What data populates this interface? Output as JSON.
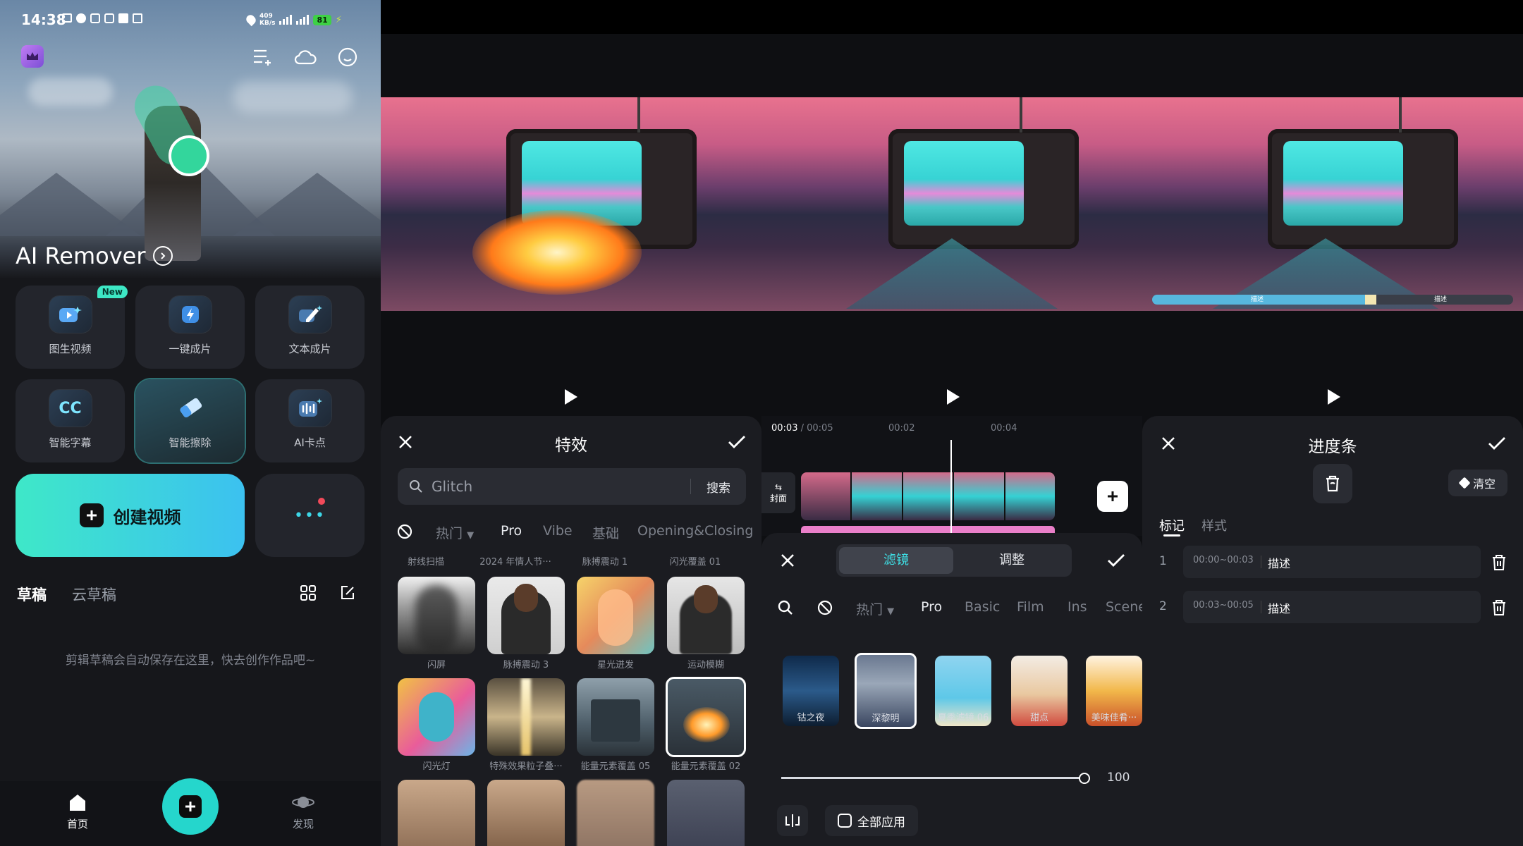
{
  "status_bar": {
    "time": "14:38",
    "net_speed": "409",
    "net_unit": "KB/s",
    "battery": "81"
  },
  "home": {
    "hero_title": "AI Remover",
    "tools": [
      {
        "label": "图生视频",
        "badge": "New"
      },
      {
        "label": "一键成片"
      },
      {
        "label": "文本成片"
      },
      {
        "label": "智能字幕",
        "icon_text": "CC"
      },
      {
        "label": "智能擦除"
      },
      {
        "label": "AI卡点"
      }
    ],
    "create_label": "创建视频",
    "more_label": "•••",
    "draft_tabs": [
      "草稿",
      "云草稿"
    ],
    "empty_text": "剪辑草稿会自动保存在这里，快去创作作品吧~",
    "nav": {
      "home": "首页",
      "discover": "发现"
    }
  },
  "effects": {
    "title": "特效",
    "search_placeholder": "Glitch",
    "search_button": "搜索",
    "tabs": [
      "热门",
      "Pro",
      "Vibe",
      "基础",
      "Opening&Closing"
    ],
    "active_tab": "Pro",
    "top_captions": [
      "射线扫描",
      "2024 年情人节···",
      "脉搏震动 1",
      "闪光覆盖 01"
    ],
    "items": [
      "闪屏",
      "脉搏震动 3",
      "星光迸发",
      "运动模糊",
      "闪光灯",
      "特殊效果粒子叠···",
      "能量元素覆盖 05",
      "能量元素覆盖 02"
    ]
  },
  "filters": {
    "time_current": "00:03",
    "time_total": "00:05",
    "ticks": [
      "00:02",
      "00:04"
    ],
    "cover_label": "封面",
    "tabs": [
      "滤镜",
      "调整"
    ],
    "categories": [
      "热门",
      "Pro",
      "Basic",
      "Film",
      "Ins",
      "Scene"
    ],
    "items": [
      "钴之夜",
      "深黎明",
      "夏季滤镜 06",
      "甜点",
      "美味佳肴···"
    ],
    "slider_value": "100",
    "apply_all": "全部应用"
  },
  "progress": {
    "title": "进度条",
    "clear_label": "清空",
    "tabs": [
      "标记",
      "样式"
    ],
    "bar_labels": [
      "描述",
      "描述"
    ],
    "rows": [
      {
        "index": "1",
        "range": "00:00~00:03",
        "desc": "描述"
      },
      {
        "index": "2",
        "range": "00:03~00:05",
        "desc": "描述"
      }
    ]
  }
}
